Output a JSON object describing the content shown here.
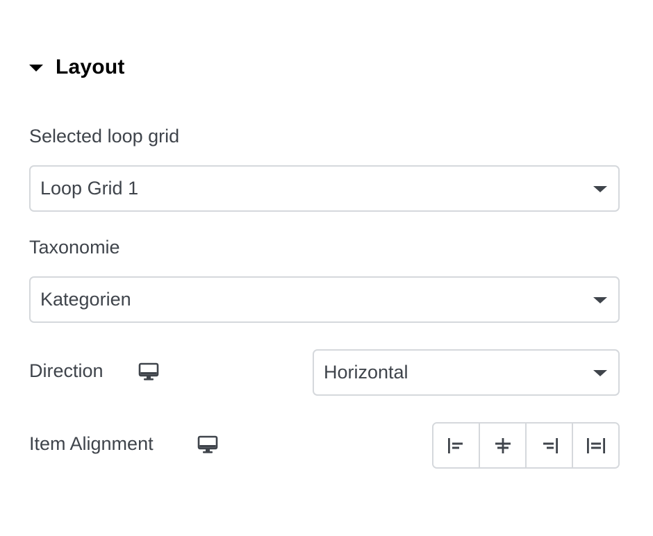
{
  "section": {
    "title": "Layout",
    "icon": "caret-down-icon"
  },
  "fields": {
    "loop_grid": {
      "label": "Selected loop grid",
      "value": "Loop Grid 1"
    },
    "taxonomy": {
      "label": "Taxonomie",
      "value": "Kategorien"
    },
    "direction": {
      "label": "Direction",
      "device_icon": "desktop-icon",
      "value": "Horizontal"
    },
    "item_alignment": {
      "label": "Item Alignment",
      "device_icon": "desktop-icon",
      "options": [
        {
          "name": "align-start-icon"
        },
        {
          "name": "align-center-icon"
        },
        {
          "name": "align-end-icon"
        },
        {
          "name": "align-stretch-icon"
        }
      ]
    }
  },
  "colors": {
    "text": "#3f444b",
    "heading": "#000000",
    "border": "#d5d8dc",
    "background": "#ffffff"
  }
}
